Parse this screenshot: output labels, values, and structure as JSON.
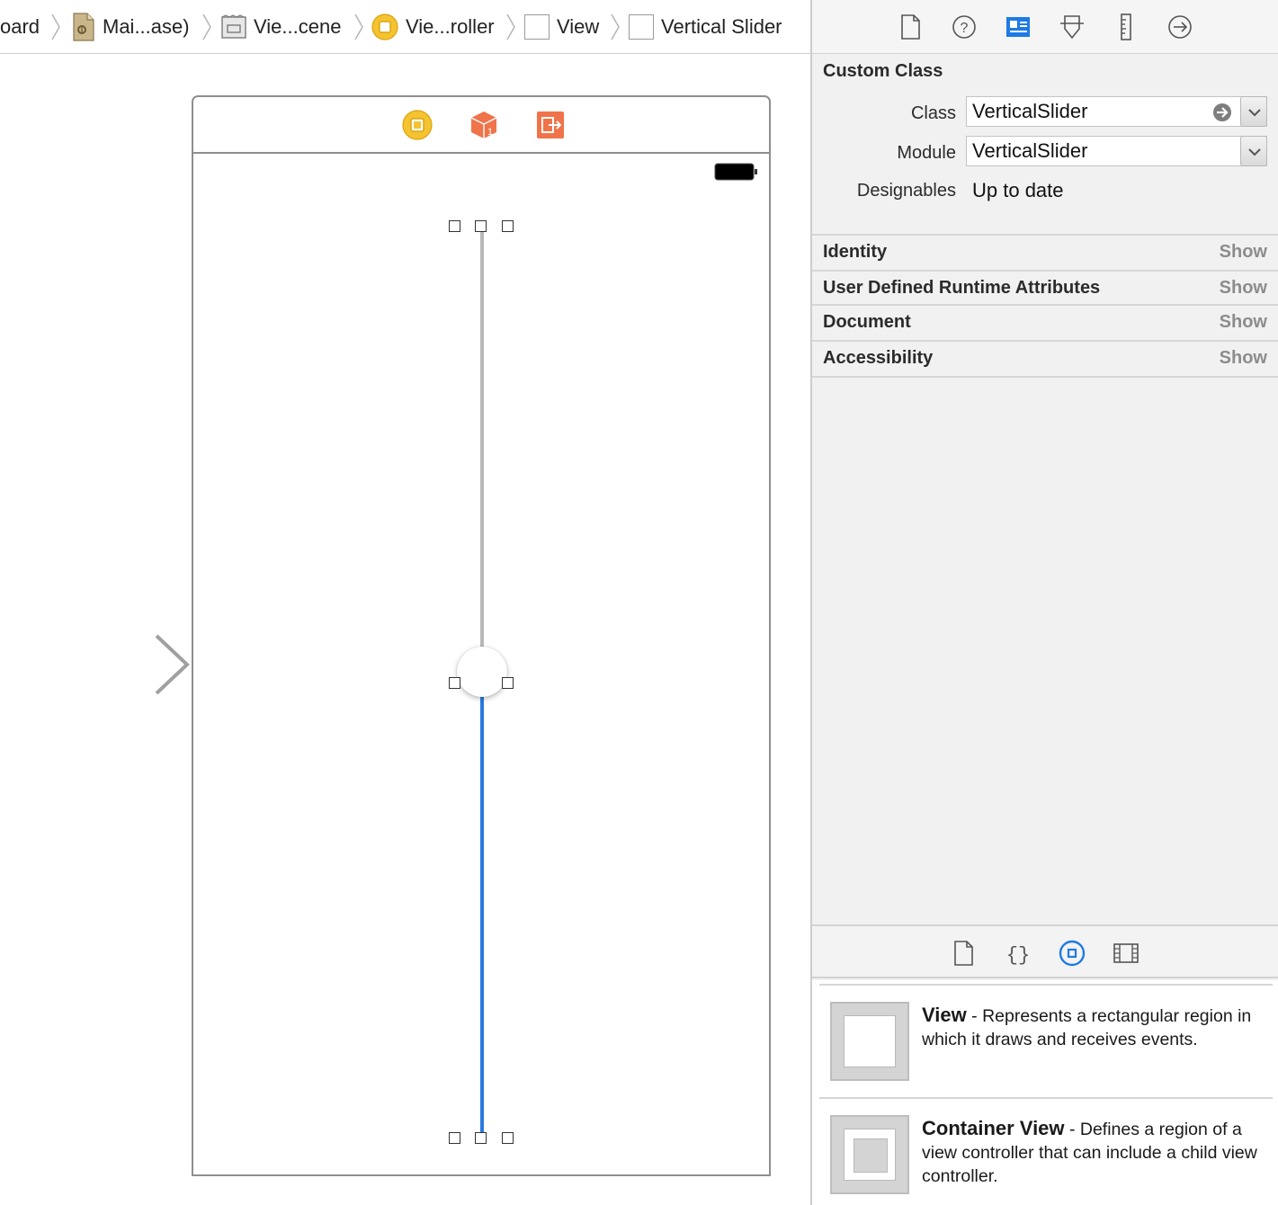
{
  "breadcrumb": {
    "items": [
      {
        "label": "oard",
        "icon": "storyboard-icon"
      },
      {
        "label": "Mai...ase)",
        "icon": "storyboard-file-icon"
      },
      {
        "label": "Vie...cene",
        "icon": "scene-icon"
      },
      {
        "label": "Vie...roller",
        "icon": "view-controller-icon"
      },
      {
        "label": "View",
        "icon": "view-icon"
      },
      {
        "label": "Vertical Slider",
        "icon": "view-icon"
      }
    ]
  },
  "canvas": {
    "scene_dock_icons": [
      "view-controller-icon",
      "first-responder-icon",
      "exit-icon"
    ],
    "slider": {
      "value_fraction": 0.51,
      "track_color": "#2a7be2",
      "max_track_color": "#b8b8b8"
    }
  },
  "inspector": {
    "tabs": [
      "file-inspector-icon",
      "quick-help-icon",
      "identity-inspector-icon",
      "attributes-inspector-icon",
      "size-inspector-icon",
      "connections-inspector-icon"
    ],
    "active_tab": "identity-inspector-icon",
    "custom_class": {
      "title": "Custom Class",
      "class_label": "Class",
      "class_value": "VerticalSlider",
      "module_label": "Module",
      "module_value": "VerticalSlider",
      "designables_label": "Designables",
      "designables_value": "Up to date"
    },
    "sections": [
      {
        "title": "Identity",
        "action": "Show"
      },
      {
        "title": "User Defined Runtime Attributes",
        "action": "Show"
      },
      {
        "title": "Document",
        "action": "Show"
      },
      {
        "title": "Accessibility",
        "action": "Show"
      }
    ],
    "library_tabs": [
      "file-template-icon",
      "code-snippet-icon",
      "object-library-icon",
      "media-library-icon"
    ],
    "library_items": [
      {
        "name": "View",
        "description": " - Represents a rectangular region in which it draws and receives events."
      },
      {
        "name": "Container View",
        "description": " - Defines a region of a view controller that can include a child view controller."
      }
    ]
  },
  "colors": {
    "accent": "#1e7ae6",
    "orange": "#f0734a",
    "yellow": "#f5c330"
  }
}
